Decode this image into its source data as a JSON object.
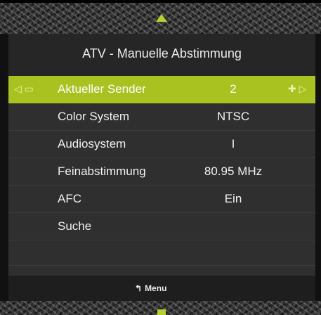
{
  "menu": {
    "title": "ATV - Manuelle Abstimmung",
    "rows": [
      {
        "label": "Aktueller Sender",
        "value": "2"
      },
      {
        "label": "Color System",
        "value": "NTSC"
      },
      {
        "label": "Audiosystem",
        "value": "I"
      },
      {
        "label": "Feinabstimmung",
        "value": "80.95 MHz"
      },
      {
        "label": "AFC",
        "value": "Ein"
      },
      {
        "label": "Suche",
        "value": ""
      }
    ],
    "nav_left": "◁ ▭",
    "nav_right": "✚ ▷"
  },
  "footer": {
    "icon": "↰",
    "label": "Menu"
  },
  "colors": {
    "accent": "#a9c21f",
    "background": "#2f2f2f",
    "title_bar": "#262626"
  }
}
